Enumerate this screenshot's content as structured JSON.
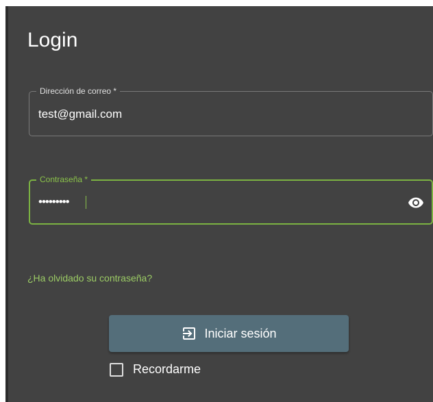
{
  "form": {
    "title": "Login",
    "email": {
      "label": "Dirección de correo *",
      "value": "test@gmail.com"
    },
    "password": {
      "label": "Contraseña *",
      "masked_value": "•••••••••",
      "toggle_icon": "eye-icon",
      "focused": true
    },
    "forgot_password_link": "¿Ha olvidado su contraseña?",
    "login_button": {
      "label": "Iniciar sesión",
      "icon": "login-icon"
    },
    "remember_me": {
      "label": "Recordarme",
      "checked": false
    }
  },
  "colors": {
    "panel_background": "#424242",
    "accent_green": "#8bc34a",
    "link_green": "#9ccc65",
    "button_background": "#546e7a",
    "text": "#ffffff"
  }
}
